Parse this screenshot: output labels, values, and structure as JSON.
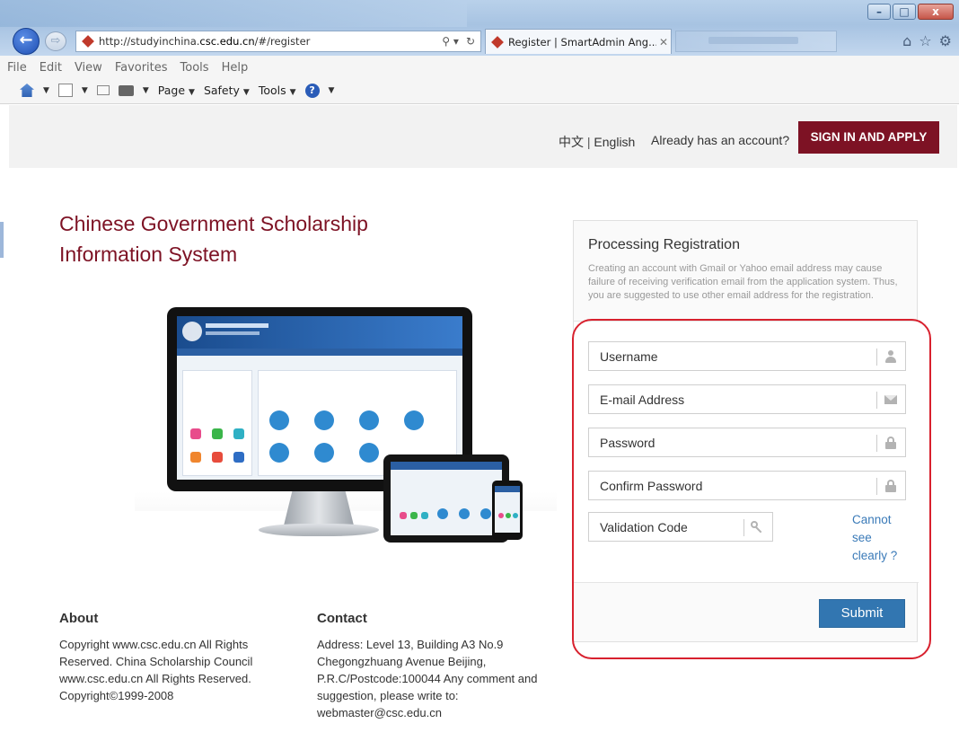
{
  "browser": {
    "url_prefix": "http://studyinchina.",
    "url_domain": "csc.edu.cn",
    "url_suffix": "/#/register",
    "tab_title": "Register | SmartAdmin Ang...",
    "tab_close": "✕",
    "menu": [
      "File",
      "Edit",
      "View",
      "Favorites",
      "Tools",
      "Help"
    ],
    "commands": {
      "page": "Page",
      "safety": "Safety",
      "tools": "Tools"
    },
    "window_controls": {
      "minimize": "–",
      "maximize": "□",
      "close": "x"
    }
  },
  "header": {
    "lang_zh": "中文",
    "lang_sep": " | ",
    "lang_en": "English",
    "already": "Already has an account?",
    "signin_button": "SIGN IN AND APPLY"
  },
  "site_title": "Chinese Government Scholarship Information System",
  "registration": {
    "title": "Processing Registration",
    "note": "Creating an account with Gmail or Yahoo email address may cause failure of receiving verification email from the application system. Thus, you are suggested to use other email address for the registration.",
    "username_placeholder": "Username",
    "email_placeholder": "E-mail Address",
    "password_placeholder": "Password",
    "confirm_placeholder": "Confirm Password",
    "validation_placeholder": "Validation Code",
    "cannot_see": "Cannot see clearly ?",
    "submit": "Submit"
  },
  "footer": {
    "about_title": "About",
    "about_text": "Copyright www.csc.edu.cn All Rights Reserved. China Scholarship Council www.csc.edu.cn All Rights Reserved. Copyright©1999-2008",
    "contact_title": "Contact",
    "contact_text": "Address: Level 13, Building A3 No.9 Chegongzhuang Avenue Beijing, P.R.C/Postcode:100044 Any comment and suggestion, please write to: webmaster@csc.edu.cn"
  },
  "colors": {
    "brand": "#7d1224",
    "submit": "#3276b1",
    "link": "#3a7ab8",
    "highlight": "#d8212e"
  }
}
